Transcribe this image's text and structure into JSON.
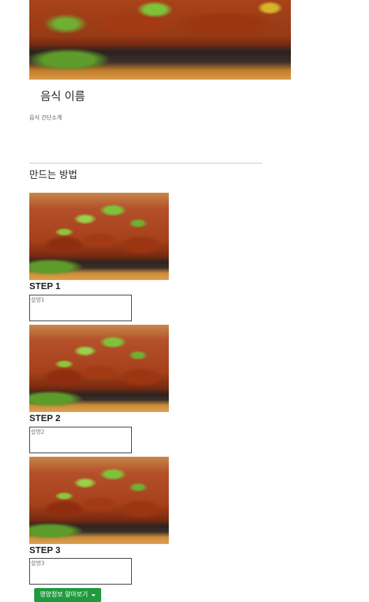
{
  "food": {
    "name": "음식 이름",
    "intro": "음식 간단소개",
    "hero_image": "food-photo"
  },
  "method": {
    "title": "만드는 방법",
    "steps": [
      {
        "label": "STEP 1",
        "description": "설명1",
        "image": "food-photo"
      },
      {
        "label": "STEP 2",
        "description": "설명2",
        "image": "food-photo"
      },
      {
        "label": "STEP 3",
        "description": "설명3",
        "image": "food-photo"
      }
    ]
  },
  "nutrition_button": {
    "label": "영양정보 알아보기",
    "icon": "caret-down-icon",
    "color": "#1f9a3e"
  }
}
